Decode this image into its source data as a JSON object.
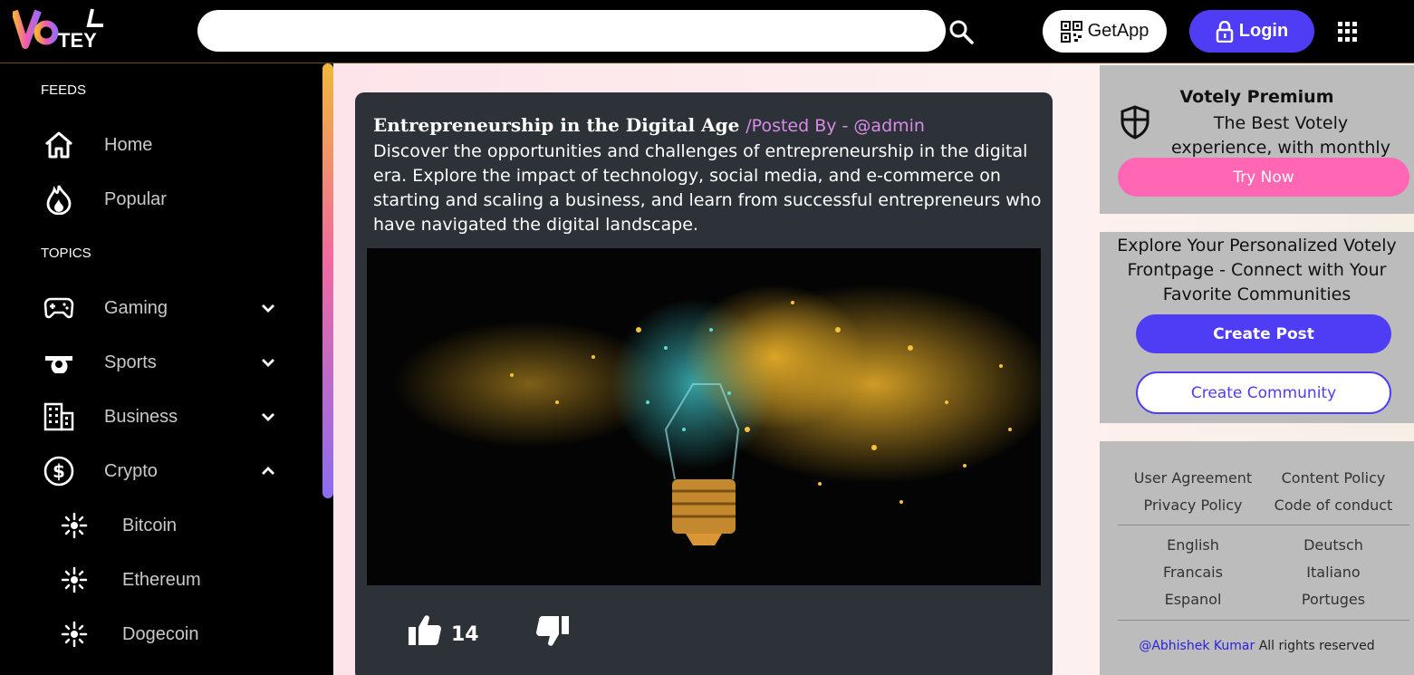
{
  "brand": {
    "logo_text": "VOTELY"
  },
  "header": {
    "search_placeholder": "",
    "getapp_label": "GetApp",
    "login_label": "Login"
  },
  "sidebar": {
    "feeds_title": "FEEDS",
    "topics_title": "TOPICS",
    "feeds": [
      {
        "label": "Home",
        "icon": "home-icon"
      },
      {
        "label": "Popular",
        "icon": "fire-icon"
      }
    ],
    "topics": [
      {
        "label": "Gaming",
        "icon": "gamepad-icon",
        "expanded": false
      },
      {
        "label": "Sports",
        "icon": "whistle-icon",
        "expanded": false
      },
      {
        "label": "Business",
        "icon": "building-icon",
        "expanded": false
      },
      {
        "label": "Crypto",
        "icon": "dollar-coin-icon",
        "expanded": true
      }
    ],
    "crypto_items": [
      {
        "label": "Bitcoin",
        "icon": "sparkle-icon"
      },
      {
        "label": "Ethereum",
        "icon": "sparkle-icon"
      },
      {
        "label": "Dogecoin",
        "icon": "sparkle-icon"
      }
    ]
  },
  "post": {
    "title": "Entrepreneurship in the Digital Age",
    "posted_by": "/Posted By - @admin",
    "description": "Discover the opportunities and challenges of entrepreneurship in the digital era. Explore the impact of technology, social media, and e-commerce on starting and scaling a business, and learn from successful entrepreneurs who have navigated the digital landscape.",
    "image": "exploding-light-bulb",
    "likes": "14"
  },
  "premium": {
    "title": "Votely Premium",
    "subtitle": "The Best Votely experience, with monthly coins",
    "cta": "Try Now"
  },
  "explore": {
    "text": "Explore Your Personalized Votely Frontpage - Connect with Your Favorite Communities",
    "create_post": "Create Post",
    "create_community": "Create Community"
  },
  "footer": {
    "links": [
      "User Agreement",
      "Content Policy",
      "Privacy Policy",
      "Code of conduct"
    ],
    "languages": [
      "English",
      "Deutsch",
      "Francais",
      "Italiano",
      "Espanol",
      "Portuges"
    ],
    "author": "@Abhishek Kumar",
    "rights": "All rights reserved"
  },
  "colors": {
    "accent": "#4f3cf5",
    "pink": "#ff66b3",
    "card_bg": "#2c3238"
  }
}
